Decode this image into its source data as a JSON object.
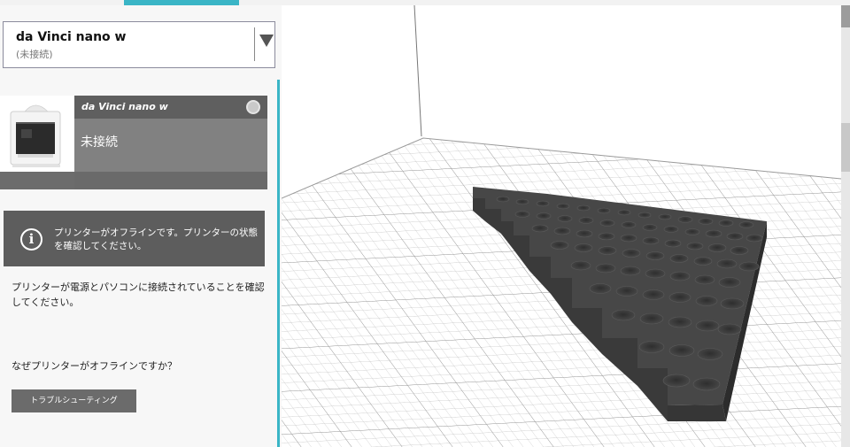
{
  "printer_select": {
    "name": "da Vinci nano w",
    "status": "(未接続)"
  },
  "printer_card": {
    "name": "da Vinci nano w",
    "state": "未接続"
  },
  "alert": {
    "message": "プリンターがオフラインです。プリンターの状態を確認してください。"
  },
  "help_text": "プリンターが電源とパソコンに接続されていることを確認してください。",
  "why_text": "なぜプリンターがオフラインですか？",
  "troubleshoot_label": "トラブルシューティング",
  "colors": {
    "accent": "#3ab5c6",
    "panel_dark": "#5d5d5d",
    "model": "#404040"
  },
  "icons": [
    "dropdown-caret-icon",
    "printer-thumbnail",
    "status-dot-icon",
    "info-icon"
  ]
}
